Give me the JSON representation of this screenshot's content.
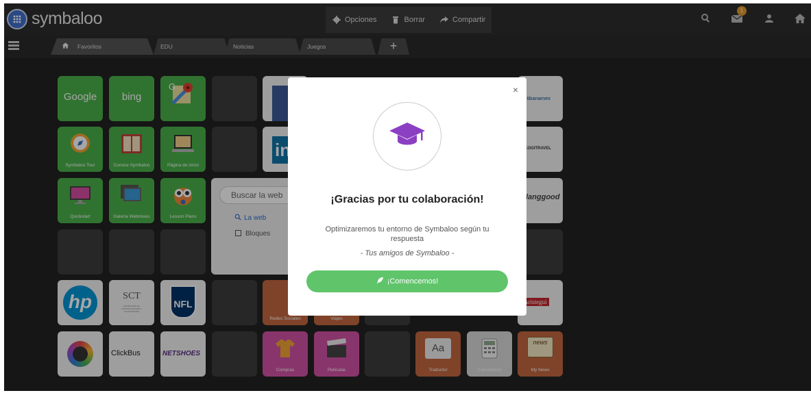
{
  "brand": {
    "name": "symbaloo"
  },
  "toolbar": {
    "options": "Opciones",
    "delete": "Borrar",
    "share": "Compartir"
  },
  "header_icons": [
    "search-icon",
    "mail-icon",
    "user-icon",
    "home-icon"
  ],
  "mail_badge": "1",
  "tabs": [
    {
      "label": "Favoritos"
    },
    {
      "label": "EDU"
    },
    {
      "label": "Noticias"
    },
    {
      "label": "Juegos"
    }
  ],
  "tab_add": "+",
  "tiles": {
    "google": "Google",
    "bing": "bing",
    "maps": "G",
    "banamex": "citibanamex",
    "symbaloo_tour": "Symbaloo Tour",
    "conoce": "Conoce Symbaloo",
    "pagina_inicio": "Página de inicio",
    "kogi": "KOGITRAVEL",
    "quickstart": "Quickstart",
    "galeria": "Galería Webmixes",
    "lesson": "Lesson Plans",
    "lang": "langgood",
    "hp": "hp",
    "sct": "SCT",
    "sct_sub": "SECRETARÍA DE COMUNICACIONES Y TRANSPORTES",
    "nfl": "NFL",
    "redes": "Redes Sociales",
    "viajes": "Viajes",
    "aristegui": "Aristegui",
    "clickbus": "ClickBus",
    "netshoes": "NETSHOES",
    "compras": "Compras",
    "peliculas": "Películas",
    "traductor": "Traductor",
    "traductor_icon": "Aa",
    "calculadora": "Calculadora",
    "mynews": "My News",
    "news_icon": "news",
    "linkedin": "in"
  },
  "search_widget": {
    "placeholder": "Buscar la web",
    "option_web": "La web",
    "option_blocks": "Bloques"
  },
  "modal": {
    "title": "¡Gracias por tu colaboración!",
    "body": "Optimizaremos tu entorno de Symbaloo según tu respuesta",
    "signature": "- Tus amigos de Symbaloo -",
    "button": "¡Comencemos!",
    "close": "×"
  },
  "colors": {
    "accent_green": "#5fc46a",
    "modal_icon": "#8b3fc2",
    "tile_green": "#4bb14a",
    "tile_orange": "#c3683f",
    "tile_pink": "#d252a7"
  }
}
